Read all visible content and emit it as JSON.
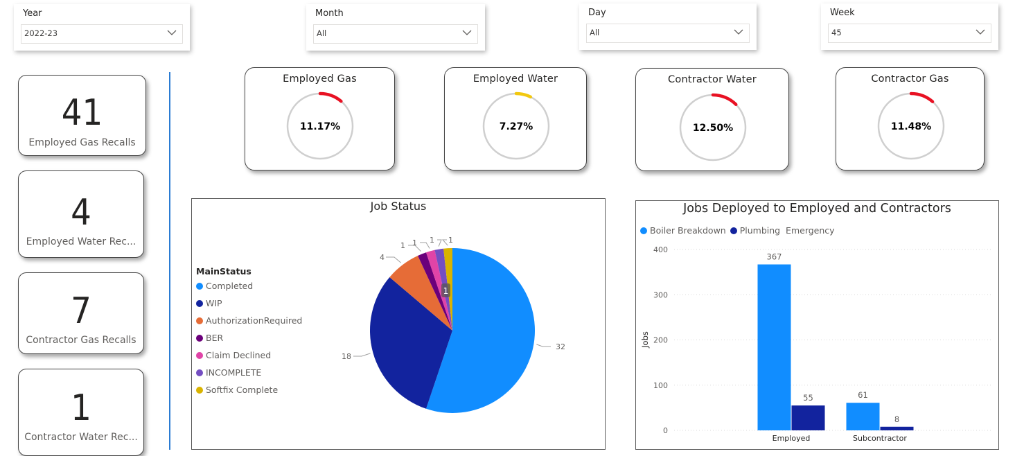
{
  "slicers": [
    {
      "label": "Year",
      "value": "2022-23"
    },
    {
      "label": "Month",
      "value": "All"
    },
    {
      "label": "Day",
      "value": "All"
    },
    {
      "label": "Week",
      "value": "45"
    }
  ],
  "cards": [
    {
      "value": "41",
      "caption": "Employed Gas Recalls"
    },
    {
      "value": "4",
      "caption": "Employed Water Rec..."
    },
    {
      "value": "7",
      "caption": "Contractor Gas Recalls"
    },
    {
      "value": "1",
      "caption": "Contractor Water Rec..."
    }
  ],
  "gauges": [
    {
      "title": "Employed Gas",
      "label": "11.17%",
      "fraction": 0.1117,
      "color": "#e81123"
    },
    {
      "title": "Employed Water",
      "label": "7.27%",
      "fraction": 0.0727,
      "color": "#f2c80f"
    },
    {
      "title": "Contractor Water",
      "label": "12.50%",
      "fraction": 0.125,
      "color": "#e81123"
    },
    {
      "title": "Contractor Gas",
      "label": "11.48%",
      "fraction": 0.1148,
      "color": "#e81123"
    }
  ],
  "pie": {
    "title": "Job Status",
    "legend_title": "MainStatus",
    "slices": [
      {
        "name": "Completed",
        "value": 32,
        "color": "#118dff",
        "label": "32"
      },
      {
        "name": "WIP",
        "value": 18,
        "color": "#12239e",
        "label": "18"
      },
      {
        "name": "AuthorizationRequired",
        "value": 4,
        "color": "#e66c37",
        "label": "4"
      },
      {
        "name": "BER",
        "value": 1,
        "color": "#6b007b",
        "label": "1"
      },
      {
        "name": "Claim Declined",
        "value": 1,
        "color": "#e044a7",
        "label": "1"
      },
      {
        "name": "INCOMPLETE",
        "value": 1,
        "color": "#744ec2",
        "label": "1"
      },
      {
        "name": "Softfix Complete",
        "value": 1,
        "color": "#d9b300",
        "label": "1"
      }
    ],
    "tooltip_badge": "1"
  },
  "chart_data": {
    "type": "bar",
    "title": "Jobs Deployed to Employed and Contractors",
    "categories": [
      "Employed",
      "Subcontractor"
    ],
    "series": [
      {
        "name": "Boiler Breakdown",
        "values": [
          367,
          61
        ],
        "color": "#118dff"
      },
      {
        "name": "Plumbing  Emergency",
        "values": [
          55,
          8
        ],
        "color": "#12239e"
      }
    ],
    "ylabel": "Jobs",
    "xlabel": "",
    "ylim": [
      0,
      400
    ],
    "yticks": [
      0,
      100,
      200,
      300,
      400
    ],
    "grid": true,
    "legend_position": "top-left"
  }
}
